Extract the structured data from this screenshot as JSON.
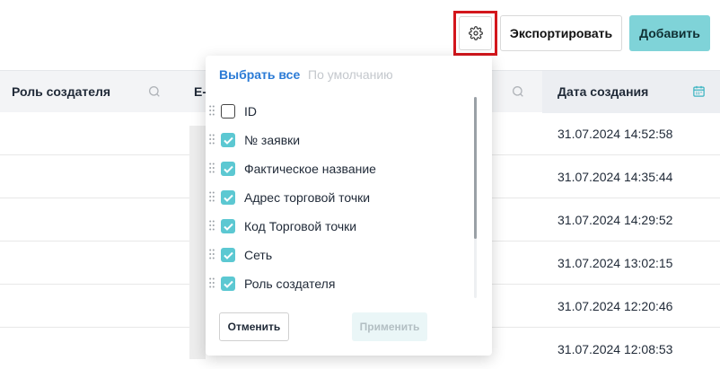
{
  "toolbar": {
    "settings_icon": "gear-icon",
    "export_label": "Экспортировать",
    "add_label": "Добавить",
    "add_color": "#7fd3d8",
    "highlight_color": "#d3161c"
  },
  "table": {
    "columns": [
      {
        "label": "Роль создателя",
        "icon": "search-icon"
      },
      {
        "label": "E-",
        "icon": "search-icon"
      },
      {
        "label": "Дата создания",
        "icon": "calendar-icon"
      }
    ],
    "rows": [
      {
        "date": "31.07.2024 14:52:58"
      },
      {
        "date": "31.07.2024 14:35:44"
      },
      {
        "date": "31.07.2024 14:29:52"
      },
      {
        "date": "31.07.2024 13:02:15"
      },
      {
        "date": "31.07.2024 12:20:46"
      },
      {
        "date": "31.07.2024 12:08:53"
      }
    ]
  },
  "column_settings": {
    "select_all": "Выбрать все",
    "default": "По умолчанию",
    "items": [
      {
        "label": "ID",
        "checked": false
      },
      {
        "label": "№ заявки",
        "checked": true
      },
      {
        "label": "Фактическое название",
        "checked": true
      },
      {
        "label": "Адрес торговой точки",
        "checked": true
      },
      {
        "label": "Код Торговой точки",
        "checked": true
      },
      {
        "label": "Сеть",
        "checked": true
      },
      {
        "label": "Роль создателя",
        "checked": true
      }
    ],
    "cancel": "Отменить",
    "apply": "Применить",
    "checkbox_color": "#5cc8d2"
  }
}
